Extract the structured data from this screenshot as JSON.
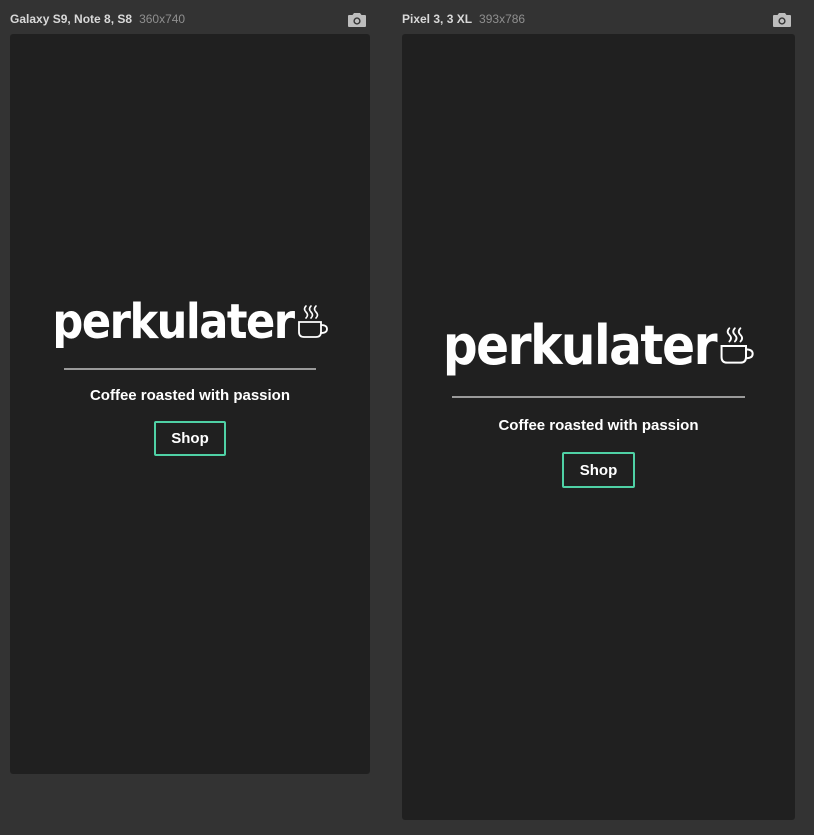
{
  "devices": [
    {
      "name": "Galaxy S9, Note 8, S8",
      "dimensions": "360x740",
      "screenshot_icon": "camera-icon",
      "page": {
        "logo_text": "perkulater",
        "logo_icon": "coffee-cup-icon",
        "tagline": "Coffee roasted with passion",
        "button_label": "Shop"
      }
    },
    {
      "name": "Pixel 3, 3 XL",
      "dimensions": "393x786",
      "screenshot_icon": "camera-icon",
      "page": {
        "logo_text": "perkulater",
        "logo_icon": "coffee-cup-icon",
        "tagline": "Coffee roasted with passion",
        "button_label": "Shop"
      }
    }
  ],
  "colors": {
    "app_background": "#333333",
    "viewport_background": "#202020",
    "button_border": "#4fd1a5",
    "text": "#ffffff",
    "rule": "#9a9a9a"
  }
}
